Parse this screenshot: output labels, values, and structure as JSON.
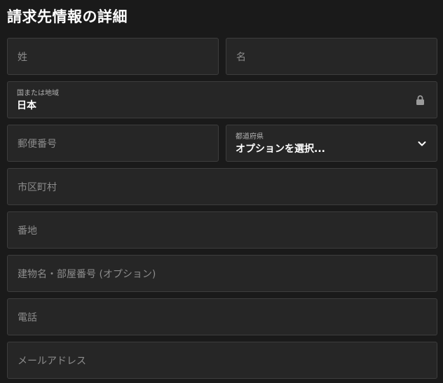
{
  "form": {
    "title": "請求先情報の詳細",
    "last_name_placeholder": "姓",
    "first_name_placeholder": "名",
    "country": {
      "label": "国または地域",
      "value": "日本",
      "icon": "lock-icon"
    },
    "postal_code_placeholder": "郵便番号",
    "prefecture": {
      "label": "都道府県",
      "value": "オプションを選択...",
      "icon": "chevron-down-icon"
    },
    "city_placeholder": "市区町村",
    "address_placeholder": "番地",
    "building_placeholder": "建物名・部屋番号 (オプション)",
    "phone_placeholder": "電話",
    "email_placeholder": "メールアドレス"
  }
}
